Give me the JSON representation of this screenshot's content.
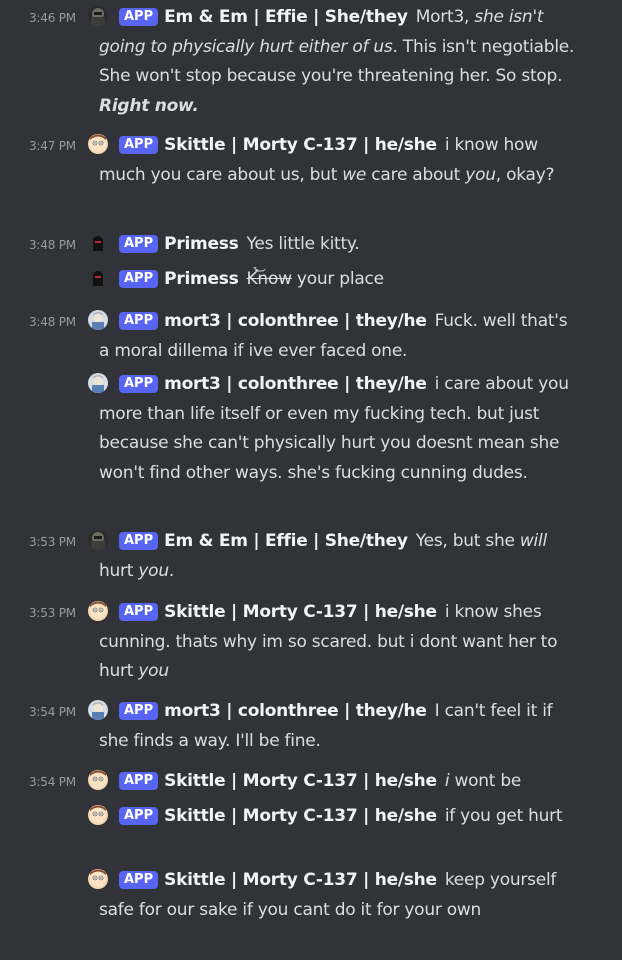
{
  "badge": "APP",
  "users": {
    "em": "Em & Em | Effie | She/they",
    "skittle": "Skittle | Morty C-137 | he/she",
    "primess": "Primess",
    "mort3": "mort3 | colonthree | they/he"
  },
  "messages": [
    {
      "time": "3:46 PM",
      "p1": "Mort3, ",
      "i1": "she isn't going to physically hurt either of us",
      "p2": ". This isn't negotiable. She won't stop because you're threatening her. So stop. ",
      "bi1": "Right now."
    },
    {
      "time": "3:47 PM",
      "p1": "i know how much you care about us, but ",
      "i1": "we",
      "p2": " care about ",
      "i2": "you",
      "p3": ", okay?"
    },
    {
      "time": "3:48 PM",
      "p1": "Yes little kitty."
    },
    {
      "p1": "Know",
      "marks": "́̀͛̽͝͝",
      "p2": "your place"
    },
    {
      "time": "3:48 PM",
      "p1": "Fuck. well that's a moral dillema if ive ever faced one."
    },
    {
      "p1": "i care about you more than life itself or even my fucking tech. but just because she can't physically hurt you doesnt mean she won't find other ways. she's fucking cunning dudes."
    },
    {
      "time": "3:53 PM",
      "p1": "Yes, but she ",
      "i1": "will",
      "p2": " hurt ",
      "i2": "you",
      "p3": "."
    },
    {
      "time": "3:53 PM",
      "p1": "i know shes cunning. thats why im so scared. but i dont want her to hurt ",
      "i1": "you"
    },
    {
      "time": "3:54 PM",
      "p1": "I can't feel it if she finds a way. I'll be fine."
    },
    {
      "time": "3:54 PM",
      "i1": "i",
      "p1": " wont be"
    },
    {
      "p1": "if you get hurt"
    },
    {
      "p1": "keep yourself safe for our sake if you cant do it for your own"
    }
  ]
}
